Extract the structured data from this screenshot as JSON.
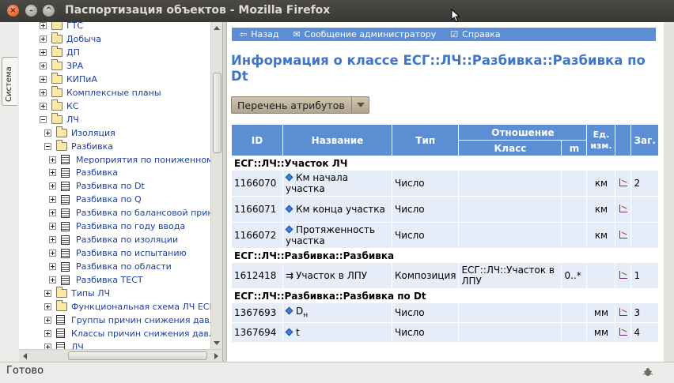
{
  "window": {
    "title": "Паспортизация объектов - Mozilla Firefox"
  },
  "side_tab": {
    "label": "Система"
  },
  "tree": {
    "items": [
      {
        "label": "ГТС",
        "icon": "folder-icon",
        "expander": "plus",
        "level": 1
      },
      {
        "label": "Добыча",
        "icon": "folder-icon",
        "expander": "plus",
        "level": 1
      },
      {
        "label": "ДП",
        "icon": "folder-icon",
        "expander": "plus",
        "level": 1
      },
      {
        "label": "ЗРА",
        "icon": "folder-icon",
        "expander": "plus",
        "level": 1
      },
      {
        "label": "КИПиА",
        "icon": "folder-icon",
        "expander": "plus",
        "level": 1
      },
      {
        "label": "Комплексные планы",
        "icon": "folder-icon",
        "expander": "plus",
        "level": 1
      },
      {
        "label": "КС",
        "icon": "folder-icon",
        "expander": "plus",
        "level": 1
      },
      {
        "label": "ЛЧ",
        "icon": "folder-icon",
        "expander": "minus",
        "level": 1
      },
      {
        "label": "Изоляция",
        "icon": "folder-icon",
        "expander": "plus",
        "level": 2
      },
      {
        "label": "Разбивка",
        "icon": "folder-icon",
        "expander": "minus",
        "level": 2
      },
      {
        "label": "Мероприятия по пониженному",
        "icon": "doc-icon",
        "expander": "plus",
        "level": 3
      },
      {
        "label": "Разбивка",
        "icon": "doc-icon",
        "expander": "plus",
        "level": 3
      },
      {
        "label": "Разбивка по Dt",
        "icon": "doc-icon",
        "expander": "plus",
        "level": 3
      },
      {
        "label": "Разбивка по Q",
        "icon": "doc-icon",
        "expander": "plus",
        "level": 3
      },
      {
        "label": "Разбивка по балансовой прина",
        "icon": "doc-icon",
        "expander": "plus",
        "level": 3
      },
      {
        "label": "Разбивка по году ввода",
        "icon": "doc-icon",
        "expander": "plus",
        "level": 3
      },
      {
        "label": "Разбивка по изоляции",
        "icon": "doc-icon",
        "expander": "plus",
        "level": 3
      },
      {
        "label": "Разбивка по испытанию",
        "icon": "doc-icon",
        "expander": "plus",
        "level": 3
      },
      {
        "label": "Разбивка по области",
        "icon": "doc-icon",
        "expander": "plus",
        "level": 3
      },
      {
        "label": "Разбивка ТЕСТ",
        "icon": "doc-icon",
        "expander": "plus",
        "level": 3
      },
      {
        "label": "Типы ЛЧ",
        "icon": "folder-icon",
        "expander": "plus",
        "level": 2
      },
      {
        "label": "Функциональная схема ЛЧ ЕСГ",
        "icon": "folder-icon",
        "expander": "plus",
        "level": 2
      },
      {
        "label": "Группы причин снижения давл",
        "icon": "doc-icon",
        "expander": "plus",
        "level": 2
      },
      {
        "label": "Классы причин снижения давле",
        "icon": "doc-icon",
        "expander": "plus",
        "level": 2
      },
      {
        "label": "ЛЧ",
        "icon": "doc-icon",
        "expander": "plus",
        "level": 2
      }
    ]
  },
  "toolbar": {
    "back_label": "Назад",
    "message_label": "Сообщение администратору",
    "help_label": "Справка"
  },
  "main": {
    "title": "Информация о классе ЕСГ::ЛЧ::Разбивка::Разбивка по Dt",
    "attr_button_label": "Перечень атрибутов"
  },
  "table": {
    "headers": {
      "id": "ID",
      "name": "Название",
      "type": "Тип",
      "relation": "Отношение",
      "class": "Класс",
      "m": "m",
      "unit": "Ед. изм.",
      "load": "Заг."
    },
    "groups": [
      {
        "title": "ЕСГ::ЛЧ::Участок ЛЧ",
        "rows": [
          {
            "id": "1166070",
            "name": "Км начала участка",
            "type": "Число",
            "class": "",
            "m": "",
            "unit": "км",
            "load": "2",
            "icon": "attribute-icon"
          },
          {
            "id": "1166071",
            "name": "Км конца участка",
            "type": "Число",
            "class": "",
            "m": "",
            "unit": "км",
            "load": "",
            "icon": "attribute-icon"
          },
          {
            "id": "1166072",
            "name": "Протяженность участка",
            "type": "Число",
            "class": "",
            "m": "",
            "unit": "км",
            "load": "",
            "icon": "attribute-icon"
          }
        ]
      },
      {
        "title": "ЕСГ::ЛЧ::Разбивка::Разбивка",
        "rows": [
          {
            "id": "1612418",
            "name": "Участок в ЛПУ",
            "type": "Композиция",
            "class": "ЕСГ::ЛЧ::Участок в ЛПУ",
            "m": "0..*",
            "unit": "",
            "load": "1",
            "icon": "relation-arrow-icon"
          }
        ]
      },
      {
        "title": "ЕСГ::ЛЧ::Разбивка::Разбивка по Dt",
        "rows": [
          {
            "id": "1367693",
            "name": "D",
            "name_sub": "н",
            "type": "Число",
            "class": "",
            "m": "",
            "unit": "мм",
            "load": "3",
            "icon": "attribute-icon"
          },
          {
            "id": "1367694",
            "name": "t",
            "type": "Число",
            "class": "",
            "m": "",
            "unit": "мм",
            "load": "4",
            "icon": "attribute-icon"
          }
        ]
      }
    ]
  },
  "status": {
    "text": "Готово"
  }
}
